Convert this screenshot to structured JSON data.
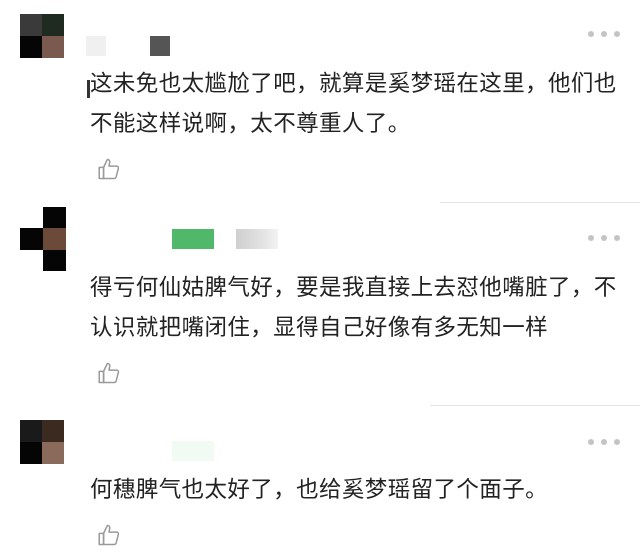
{
  "comments": [
    {
      "text": "这未免也太尴尬了吧，就算是奚梦瑶在这里，他们也不能这样说啊，太不尊重人了。",
      "avatar_colors": [
        "#3a3a3a",
        "#1f2a20",
        "#050505",
        "#7a5a4e"
      ]
    },
    {
      "text": "得亏何仙姑脾气好，要是我直接上去怼他嘴脏了，不认识就把嘴闭住，显得自己好像有多无知一样",
      "avatar_colors": [
        "#ffffff",
        "#050505",
        "#050505",
        "#6b4a3a"
      ]
    },
    {
      "text": "何穗脾气也太好了，也给奚梦瑶留了个面子。",
      "avatar_colors": [
        "#1a1a1a",
        "#3a2a20",
        "#050505",
        "#8a6a5a"
      ]
    }
  ],
  "colors": {
    "text": "#222222",
    "icon_gray": "#c4c4c4",
    "like_gray": "#9a9a9a",
    "divider": "#e6e6e6",
    "name_blur_green": "#4fb86a"
  }
}
